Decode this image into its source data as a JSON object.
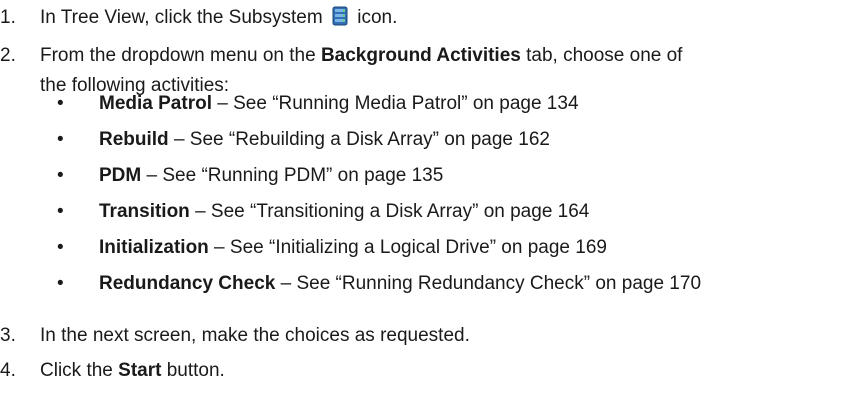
{
  "steps": [
    {
      "num": "1.",
      "before_icon": "In Tree View, click the Subsystem ",
      "icon": "subsystem-icon",
      "after_icon": " icon."
    },
    {
      "num": "2.",
      "text_a": "From the dropdown menu on the ",
      "bold": "Background Activities",
      "text_b": " tab, choose one of",
      "line2": "the following activities:"
    },
    {
      "num": "3.",
      "text": "In the next screen, make the choices as requested."
    },
    {
      "num": "4.",
      "text_a": "Click the ",
      "bold": "Start",
      "text_b": " button."
    }
  ],
  "bullets": [
    {
      "dot": "•",
      "name": "Media Patrol",
      "desc": " – See “Running Media Patrol” on page 134"
    },
    {
      "dot": "•",
      "name": "Rebuild",
      "desc": " – See “Rebuilding a Disk Array” on page 162"
    },
    {
      "dot": "•",
      "name": "PDM",
      "desc": " – See “Running PDM” on page 135"
    },
    {
      "dot": "•",
      "name": "Transition",
      "desc": " – See “Transitioning a Disk Array” on page 164"
    },
    {
      "dot": "•",
      "name": "Initialization",
      "desc": " – See “Initializing a Logical Drive” on page 169"
    },
    {
      "dot": "•",
      "name": "Redundancy Check",
      "desc": " – See “Running Redundancy Check” on page 170"
    }
  ]
}
